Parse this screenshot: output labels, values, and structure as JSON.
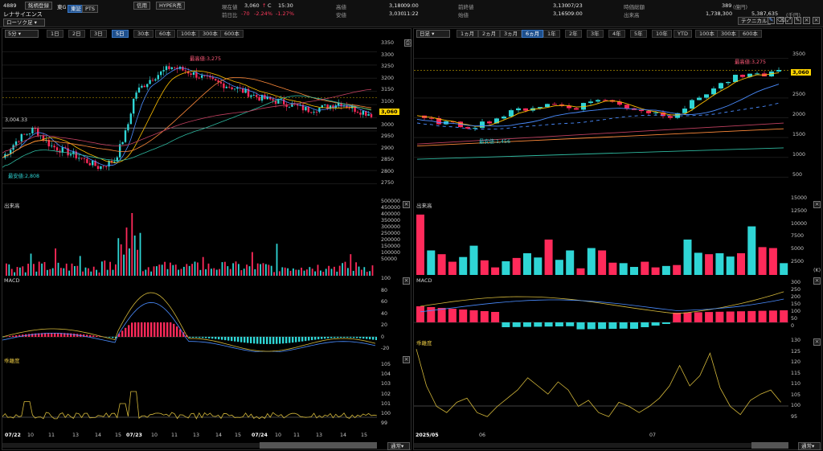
{
  "header": {
    "code": "4889",
    "name_button": "銘柄登録",
    "market": "東G",
    "venue_tabs": [
      "東証",
      "PTS"
    ],
    "name": "レナサイエンス",
    "shinyo_button": "信用",
    "hyper_button": "HYPER売",
    "price_label": "現在値",
    "price": "3,060",
    "arrow": "↑",
    "c_mark": "C",
    "time": "15:30",
    "change_label": "前日比",
    "change": "-70",
    "change_pct": "-2.24%",
    "change_pct2": "-1.27%",
    "high_label": "高値",
    "high": "3,180",
    "high_time": "09:00",
    "low_label": "安値",
    "low": "3,030",
    "low_time": "11:22",
    "prev_close_label": "前終値",
    "prev_close": "3,130",
    "prev_close_date": "07/23",
    "open_label": "始値",
    "open": "3,165",
    "open_time": "09:00",
    "market_cap_label": "時価総額",
    "market_cap": "389",
    "market_cap_unit": "(億円)",
    "volume_label": "出来高",
    "volume": "1,738,300",
    "turnover": "5,387,635",
    "turnover_unit": "(千円)",
    "chart_select": "ローソク足",
    "technical_button": "テクニカル"
  },
  "left_chart": {
    "interval": "5分",
    "periods": [
      "1日",
      "2日",
      "3日",
      "5日",
      "30本",
      "60本",
      "100本",
      "300本",
      "600本"
    ],
    "selected_period": "5日",
    "price_axis": [
      "3350",
      "3300",
      "3250",
      "3200",
      "3150",
      "3100",
      "3050",
      "3000",
      "2950",
      "2900",
      "2850",
      "2800",
      "2750"
    ],
    "high_annotation": "最高値:3,275",
    "low_annotation": "最安値:2,808",
    "level_label": "3,004.33",
    "current_tag": "3,060",
    "volume_title": "出来高",
    "volume_axis": [
      "500000",
      "450000",
      "400000",
      "350000",
      "300000",
      "250000",
      "200000",
      "150000",
      "100000",
      "50000"
    ],
    "macd_title": "MACD",
    "macd_axis": [
      "100",
      "80",
      "60",
      "40",
      "20",
      "0",
      "-20"
    ],
    "kairi_title": "乖離度",
    "kairi_axis": [
      "105",
      "104",
      "103",
      "102",
      "101",
      "100",
      "99"
    ],
    "x_labels": [
      "07/22",
      "10",
      "11",
      "13",
      "14",
      "15",
      "07/23",
      "10",
      "11",
      "13",
      "14",
      "15",
      "07/24",
      "10",
      "11",
      "13",
      "14",
      "15"
    ],
    "scroll_select": "通常"
  },
  "right_chart": {
    "interval": "日足",
    "periods": [
      "1ヵ月",
      "2ヵ月",
      "3ヵ月",
      "6ヵ月",
      "1年",
      "2年",
      "3年",
      "4年",
      "5年",
      "10年",
      "YTD",
      "100本",
      "300本",
      "600本"
    ],
    "selected_period": "6ヵ月",
    "price_axis": [
      "3500",
      "3000",
      "2500",
      "2000",
      "1500",
      "1000",
      "500"
    ],
    "high_annotation": "最高値:3,275",
    "low_annotation": "最安値:1,456",
    "current_tag": "3,060",
    "volume_title": "出来高",
    "volume_axis": [
      "15000",
      "12500",
      "10000",
      "7500",
      "5000",
      "2500"
    ],
    "volume_unit": "(K)",
    "macd_title": "MACD",
    "macd_axis": [
      "300",
      "250",
      "200",
      "150",
      "100",
      "50",
      "0"
    ],
    "kairi_title": "乖離度",
    "kairi_axis": [
      "130",
      "125",
      "120",
      "115",
      "110",
      "105",
      "100",
      "95"
    ],
    "x_labels": [
      "2025/05",
      "06",
      "07"
    ],
    "scroll_select": "通常"
  },
  "colors": {
    "up": "#2fd5d5",
    "down": "#ff2a5a",
    "accent": "#1e4f8c",
    "price_tag": "#ffd400"
  },
  "icons": [
    "close-icon",
    "pen-icon",
    "eraser-icon",
    "expand-icon",
    "chevron-down-icon"
  ]
}
